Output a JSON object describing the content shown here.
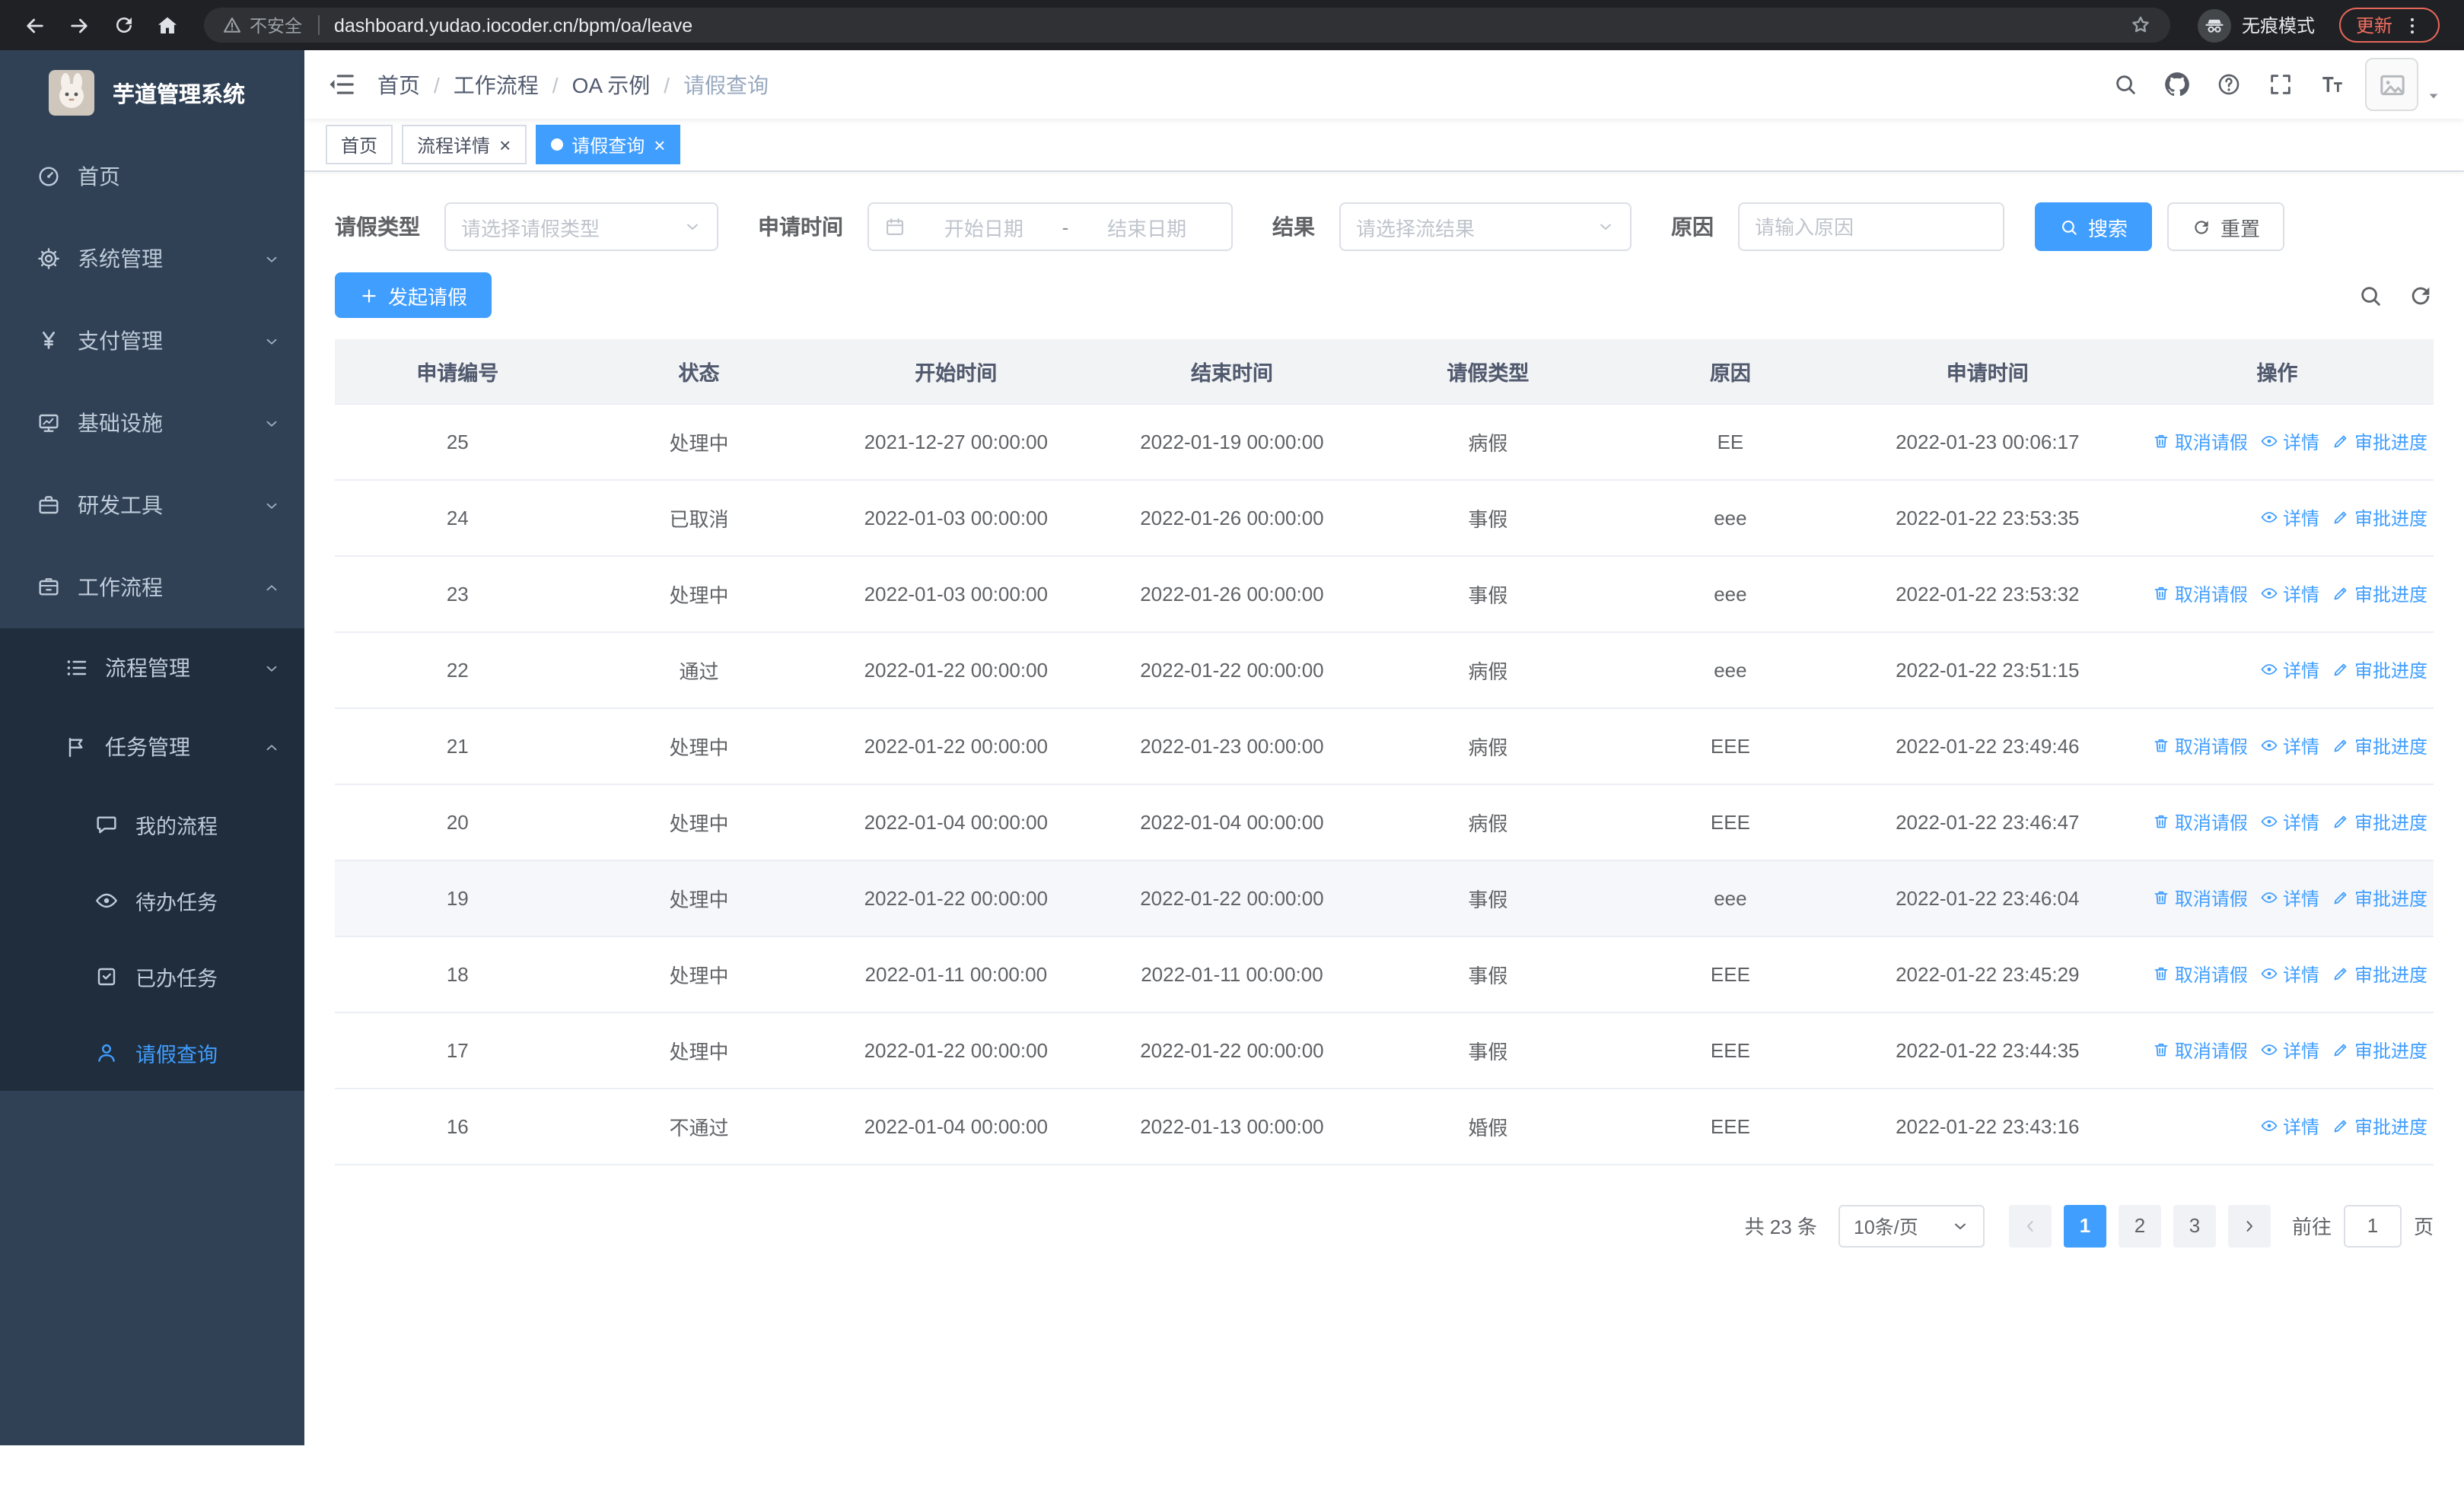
{
  "browser": {
    "security_label": "不安全",
    "url": "dashboard.yudao.iocoder.cn/bpm/oa/leave",
    "incognito_label": "无痕模式",
    "update_label": "更新"
  },
  "sidebar": {
    "logo_title": "芋道管理系统",
    "items": [
      {
        "key": "home",
        "label": "首页",
        "icon": "dashboard-icon"
      },
      {
        "key": "system-management",
        "label": "系统管理",
        "icon": "gear-icon",
        "expand": "down"
      },
      {
        "key": "payment-management",
        "label": "支付管理",
        "icon": "yen-icon",
        "expand": "down"
      },
      {
        "key": "infrastructure",
        "label": "基础设施",
        "icon": "monitor-icon",
        "expand": "down"
      },
      {
        "key": "dev-tools",
        "label": "研发工具",
        "icon": "briefcase-icon",
        "expand": "down"
      },
      {
        "key": "workflow",
        "label": "工作流程",
        "icon": "workflow-icon",
        "expand": "up",
        "children": [
          {
            "key": "process-management",
            "label": "流程管理",
            "icon": "list-icon",
            "expand": "down"
          },
          {
            "key": "task-management",
            "label": "任务管理",
            "icon": "flag-icon",
            "expand": "up",
            "children": [
              {
                "key": "my-process",
                "label": "我的流程",
                "icon": "chat-icon"
              },
              {
                "key": "todo-tasks",
                "label": "待办任务",
                "icon": "eye-icon"
              },
              {
                "key": "done-tasks",
                "label": "已办任务",
                "icon": "check-square-icon"
              },
              {
                "key": "leave-query",
                "label": "请假查询",
                "icon": "user-icon",
                "active": true
              }
            ]
          }
        ]
      }
    ]
  },
  "navbar": {
    "breadcrumb": [
      "首页",
      "工作流程",
      "OA 示例",
      "请假查询"
    ],
    "separator": "/",
    "actions": [
      {
        "name": "search-icon"
      },
      {
        "name": "github-icon"
      },
      {
        "name": "help-icon"
      },
      {
        "name": "fullscreen-icon"
      },
      {
        "name": "font-size-icon"
      }
    ]
  },
  "tabs": [
    {
      "key": "home",
      "label": "首页",
      "active": false,
      "closable": false
    },
    {
      "key": "process-detail",
      "label": "流程详情",
      "active": false,
      "closable": true
    },
    {
      "key": "leave-query",
      "label": "请假查询",
      "active": true,
      "closable": true
    }
  ],
  "filters": {
    "leave_type_label": "请假类型",
    "leave_type_placeholder": "请选择请假类型",
    "apply_time_label": "申请时间",
    "start_placeholder": "开始日期",
    "range_separator": "-",
    "end_placeholder": "结束日期",
    "result_label": "结果",
    "result_placeholder": "请选择流结果",
    "reason_label": "原因",
    "reason_placeholder": "请输入原因",
    "search_label": "搜索",
    "reset_label": "重置"
  },
  "toolbar": {
    "create_label": "发起请假"
  },
  "table": {
    "columns": [
      "申请编号",
      "状态",
      "开始时间",
      "结束时间",
      "请假类型",
      "原因",
      "申请时间",
      "操作"
    ],
    "action_defs": {
      "cancel": {
        "label": "取消请假",
        "icon": "delete-icon"
      },
      "detail": {
        "label": "详情",
        "icon": "eye-icon"
      },
      "progress": {
        "label": "审批进度",
        "icon": "edit-icon"
      }
    },
    "rows": [
      {
        "id": "25",
        "status": "处理中",
        "start": "2021-12-27 00:00:00",
        "end": "2022-01-19 00:00:00",
        "type": "病假",
        "reason": "EE",
        "applied": "2022-01-23 00:06:17",
        "actions": [
          "cancel",
          "detail",
          "progress"
        ]
      },
      {
        "id": "24",
        "status": "已取消",
        "start": "2022-01-03 00:00:00",
        "end": "2022-01-26 00:00:00",
        "type": "事假",
        "reason": "eee",
        "applied": "2022-01-22 23:53:35",
        "actions": [
          "detail",
          "progress"
        ]
      },
      {
        "id": "23",
        "status": "处理中",
        "start": "2022-01-03 00:00:00",
        "end": "2022-01-26 00:00:00",
        "type": "事假",
        "reason": "eee",
        "applied": "2022-01-22 23:53:32",
        "actions": [
          "cancel",
          "detail",
          "progress"
        ]
      },
      {
        "id": "22",
        "status": "通过",
        "start": "2022-01-22 00:00:00",
        "end": "2022-01-22 00:00:00",
        "type": "病假",
        "reason": "eee",
        "applied": "2022-01-22 23:51:15",
        "actions": [
          "detail",
          "progress"
        ]
      },
      {
        "id": "21",
        "status": "处理中",
        "start": "2022-01-22 00:00:00",
        "end": "2022-01-23 00:00:00",
        "type": "病假",
        "reason": "EEE",
        "applied": "2022-01-22 23:49:46",
        "actions": [
          "cancel",
          "detail",
          "progress"
        ]
      },
      {
        "id": "20",
        "status": "处理中",
        "start": "2022-01-04 00:00:00",
        "end": "2022-01-04 00:00:00",
        "type": "病假",
        "reason": "EEE",
        "applied": "2022-01-22 23:46:47",
        "actions": [
          "cancel",
          "detail",
          "progress"
        ]
      },
      {
        "id": "19",
        "status": "处理中",
        "start": "2022-01-22 00:00:00",
        "end": "2022-01-22 00:00:00",
        "type": "事假",
        "reason": "eee",
        "applied": "2022-01-22 23:46:04",
        "actions": [
          "cancel",
          "detail",
          "progress"
        ],
        "highlighted": true
      },
      {
        "id": "18",
        "status": "处理中",
        "start": "2022-01-11 00:00:00",
        "end": "2022-01-11 00:00:00",
        "type": "事假",
        "reason": "EEE",
        "applied": "2022-01-22 23:45:29",
        "actions": [
          "cancel",
          "detail",
          "progress"
        ]
      },
      {
        "id": "17",
        "status": "处理中",
        "start": "2022-01-22 00:00:00",
        "end": "2022-01-22 00:00:00",
        "type": "事假",
        "reason": "EEE",
        "applied": "2022-01-22 23:44:35",
        "actions": [
          "cancel",
          "detail",
          "progress"
        ]
      },
      {
        "id": "16",
        "status": "不通过",
        "start": "2022-01-04 00:00:00",
        "end": "2022-01-13 00:00:00",
        "type": "婚假",
        "reason": "EEE",
        "applied": "2022-01-22 23:43:16",
        "actions": [
          "detail",
          "progress"
        ]
      }
    ]
  },
  "pagination": {
    "total_label": "共 23 条",
    "page_size_value": "10条/页",
    "pages": [
      "1",
      "2",
      "3"
    ],
    "active_page": "1",
    "goto_label": "前往",
    "goto_value": "1",
    "unit_label": "页"
  },
  "colors": {
    "accent": "#409eff",
    "sidebar_bg": "#304156",
    "submenu_bg": "#1f2d3d",
    "chrome_bg": "#202124",
    "update_red": "#ef6d5f",
    "table_header_bg": "#f2f3f5"
  }
}
